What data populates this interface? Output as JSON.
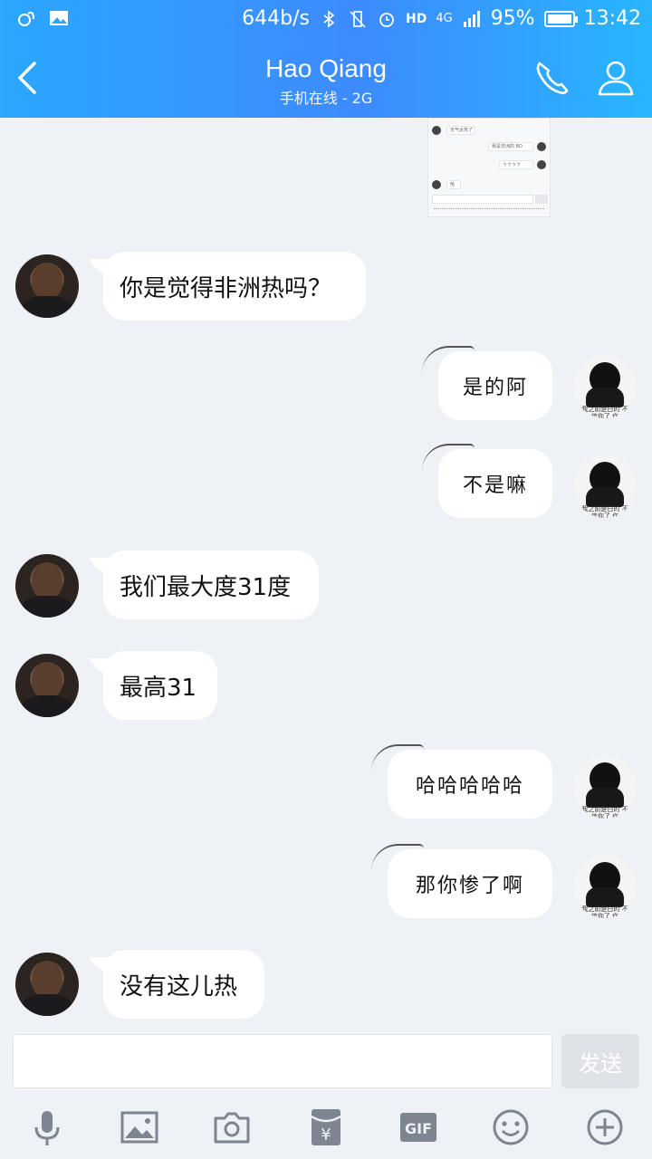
{
  "status": {
    "net_speed": "644b/s",
    "battery": "95%",
    "time": "13:42",
    "net_type": "4G"
  },
  "header": {
    "title": "Hao Qiang",
    "subtitle": "手机在线 - 2G"
  },
  "thumbnail": {
    "lines": [
      "天气太热了",
      "我是非洲的 BO",
      "ゥゥゥゥ",
      "哈"
    ]
  },
  "avatar_caption": "我之前是白的 不信你了 作",
  "messages": [
    {
      "side": "left",
      "text": "你是觉得非洲热吗？"
    },
    {
      "side": "right",
      "text": "是的阿"
    },
    {
      "side": "right",
      "text": "不是嘛"
    },
    {
      "side": "left",
      "text": "我们最大度31度"
    },
    {
      "side": "left",
      "text": "最高31"
    },
    {
      "side": "right",
      "text": "哈哈哈哈哈"
    },
    {
      "side": "right",
      "text": "那你惨了啊"
    },
    {
      "side": "left",
      "text": "没有这儿热"
    }
  ],
  "input": {
    "value": "",
    "send_label": "发送"
  },
  "toolbar": [
    "microphone-icon",
    "image-icon",
    "camera-icon",
    "red-packet-icon",
    "gif-icon",
    "emoji-icon",
    "plus-icon"
  ],
  "colors": {
    "header_start": "#2aa7ff",
    "header_end": "#27b6ff",
    "background": "#eef1f6",
    "icon_gray": "#7d8590"
  }
}
